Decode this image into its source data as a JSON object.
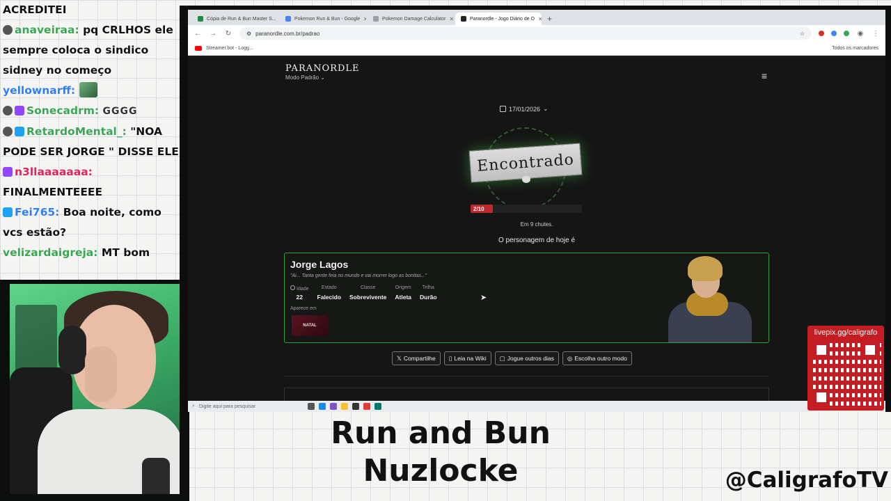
{
  "chat": {
    "lines": [
      {
        "user": "",
        "message": "ACREDITEI",
        "color": "#111"
      },
      {
        "user": "anaveiraa:",
        "message": "pq CRLHOS ele sempre coloca o sindico sidney no começo",
        "color": "#3aa655"
      },
      {
        "user": "yellownarff:",
        "message": "",
        "color": "#2e7dff"
      },
      {
        "user": "Sonecadrm:",
        "message": "GGGG",
        "color": "#3aa655"
      },
      {
        "user": "RetardoMental_:",
        "message": "\"NOA PODE SER JORGE \" DISSE ELE",
        "color": "#3aa655"
      },
      {
        "user": "n3llaaaaaaa:",
        "message": "FINALMENTEEEE",
        "color": "#e0245e"
      },
      {
        "user": "Fei765:",
        "message": "Boa noite, como vcs estão?",
        "color": "#2e7dff"
      },
      {
        "user": "velizardaigreja:",
        "message": "MT bom",
        "color": "#3aa655"
      }
    ]
  },
  "browser": {
    "tabs": [
      {
        "label": "Cópia de Run & Bun Master S...",
        "color": "#1e8e3e",
        "active": false
      },
      {
        "label": "Pokemon Run & Bun - Google",
        "color": "#4285f4",
        "active": false
      },
      {
        "label": "Pokemon Damage Calculator",
        "color": "#9aa0a6",
        "active": false
      },
      {
        "label": "Paranordle - Jogo Diário de O",
        "color": "#222222",
        "active": true
      }
    ],
    "new_tab": "+",
    "url": "paranordle.com.br/padrao",
    "bookmark": "Streamer.bot - Logg...",
    "bookmarks_right": "Todos os marcadores"
  },
  "site": {
    "logo": "PARANORDLE",
    "mode": "Modo Padrão",
    "date": "17/01/2026",
    "status": "Encontrado",
    "progress_label": "2/10",
    "progress_fraction": 0.2,
    "guesses": "Em 9 chutes.",
    "today_caption": "O personagem de hoje é",
    "character": {
      "name": "Jorge Lagos",
      "quote": "\"Ai... Tanta gente feia no mundo e vai morrer logo as bonitas...\"",
      "headers": [
        "Idade",
        "Estado",
        "Classe",
        "Origem",
        "Trilha"
      ],
      "values": [
        "22",
        "Falecido",
        "Sobrevivente",
        "Atleta",
        "Durão"
      ],
      "appears_label": "Aparece em",
      "appears_thumb": "NATAL"
    },
    "buttons": {
      "share": "Compartilhe",
      "wiki": "Leia na Wiki",
      "other_days": "Jogue outros dias",
      "other_mode": "Escolha outro modo"
    }
  },
  "taskbar": {
    "search": "Digite aqui para pesquisar"
  },
  "overlay": {
    "game_title": "Run and Bun Nuzlocke",
    "handle": "@CaligrafoTV",
    "qr_label": "livepix.gg/caligrafo",
    "accent": "#c41e24"
  }
}
